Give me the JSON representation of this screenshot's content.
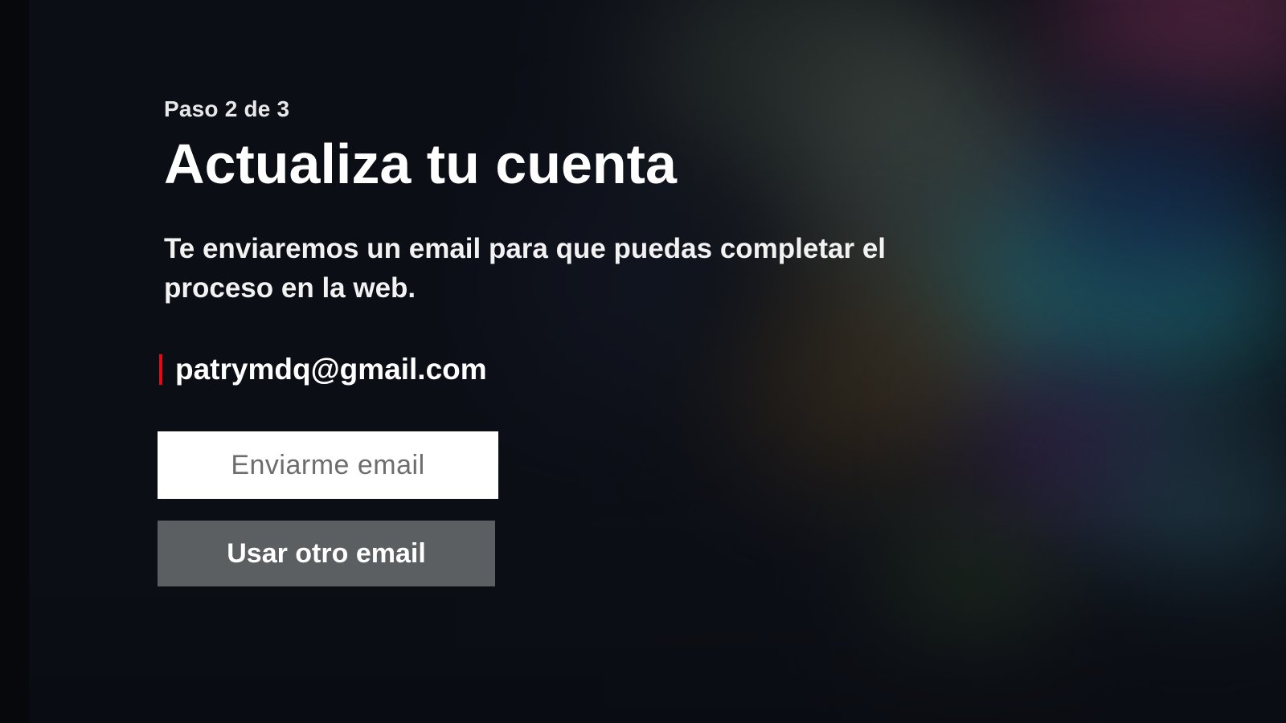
{
  "flow": {
    "step_label": "Paso 2 de 3",
    "title": "Actualiza tu cuenta",
    "description": "Te enviaremos un email para que puedas completar el proceso en la web.",
    "email": "patrymdq@gmail.com"
  },
  "actions": {
    "primary_label": "Enviarme email",
    "secondary_label": "Usar otro email"
  },
  "colors": {
    "accent_marker": "#e50914",
    "primary_button_bg": "#ffffff",
    "secondary_button_bg": "#5c5f62",
    "background": "#0d1018"
  }
}
